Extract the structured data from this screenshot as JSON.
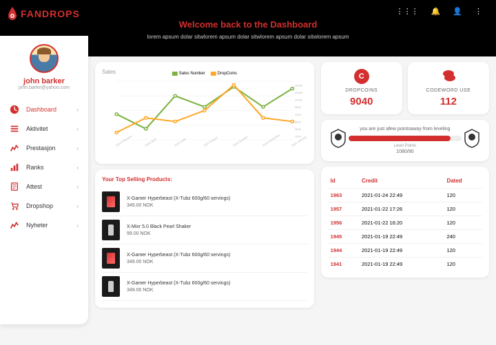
{
  "brand": "FANDROPS",
  "header": {
    "title": "Welcome back to the Dashboard",
    "subtitle": "lorem apsum dolar sitwlorem apsum dolar sitwlorem apsum dolar sitwlorem apsum"
  },
  "user": {
    "name": "john barker",
    "email": "john.barke@yahoo.com"
  },
  "nav": [
    {
      "label": "Dashboard"
    },
    {
      "label": "Aktivitet"
    },
    {
      "label": "Prestasjon"
    },
    {
      "label": "Ranks"
    },
    {
      "label": "Attest"
    },
    {
      "label": "Dropshop"
    },
    {
      "label": "Nyheter"
    }
  ],
  "chart_data": {
    "type": "line",
    "title": "Sales",
    "categories": [
      "2020 February",
      "2020 April",
      "2020 June",
      "2020 August",
      "2020 October",
      "2020 December",
      "2021 January"
    ],
    "series": [
      {
        "name": "Sales Number",
        "color": "#7cb342",
        "values": [
          7000,
          3000,
          12000,
          9000,
          14500,
          9000,
          14000
        ]
      },
      {
        "name": "DropCoins",
        "color": "#ffa726",
        "values": [
          2000,
          6000,
          5000,
          8000,
          15000,
          6000,
          5000
        ]
      }
    ],
    "ylim": [
      0,
      16000
    ],
    "yticks": [
      0,
      1000,
      2000,
      3000,
      4000,
      5000,
      6000,
      7000,
      8000,
      9000,
      10000,
      11000,
      12000,
      13000,
      14000,
      15000,
      16000
    ]
  },
  "products": {
    "title": "Your Top Selling Products:",
    "items": [
      {
        "name": "X-Gamer Hyperbeast (X-Tubz 600g/60 servings)",
        "price": "349.00 NOK",
        "img": "red"
      },
      {
        "name": "X-Mixr 5.0 Black Pearl Shaker",
        "price": "99.00 NOK",
        "img": "shaker"
      },
      {
        "name": "X-Gamer Hyperbeast (X-Tubz 600g/60 servings)",
        "price": "349.00 NOK",
        "img": "red"
      },
      {
        "name": "X-Gamer Hyperbeast (X-Tubz 600g/60 servings)",
        "price": "349.00 NOK",
        "img": "shaker"
      }
    ]
  },
  "stats": {
    "dropcoins": {
      "label": "DROPCOINS",
      "value": "9040"
    },
    "codeword": {
      "label": "CODEWORD USE",
      "value": "112"
    }
  },
  "level": {
    "text": "you are just afew pointsaway from leveling",
    "sublabel": "Level Points",
    "points": "1080/90",
    "percent": 90
  },
  "table": {
    "headers": [
      "Id",
      "Credit",
      "Dated"
    ],
    "rows": [
      {
        "id": "1963",
        "credit": "2021-01-24 22:49",
        "dated": "120"
      },
      {
        "id": "1957",
        "credit": "2021-01-22 17:26",
        "dated": "120"
      },
      {
        "id": "1956",
        "credit": "2021-01-22 16:20",
        "dated": "120"
      },
      {
        "id": "1945",
        "credit": "2021-01-19 22:49",
        "dated": "240"
      },
      {
        "id": "1944",
        "credit": "2021-01-19 22:49",
        "dated": "120"
      },
      {
        "id": "1941",
        "credit": "2021-01-19 22:49",
        "dated": "120"
      }
    ]
  }
}
